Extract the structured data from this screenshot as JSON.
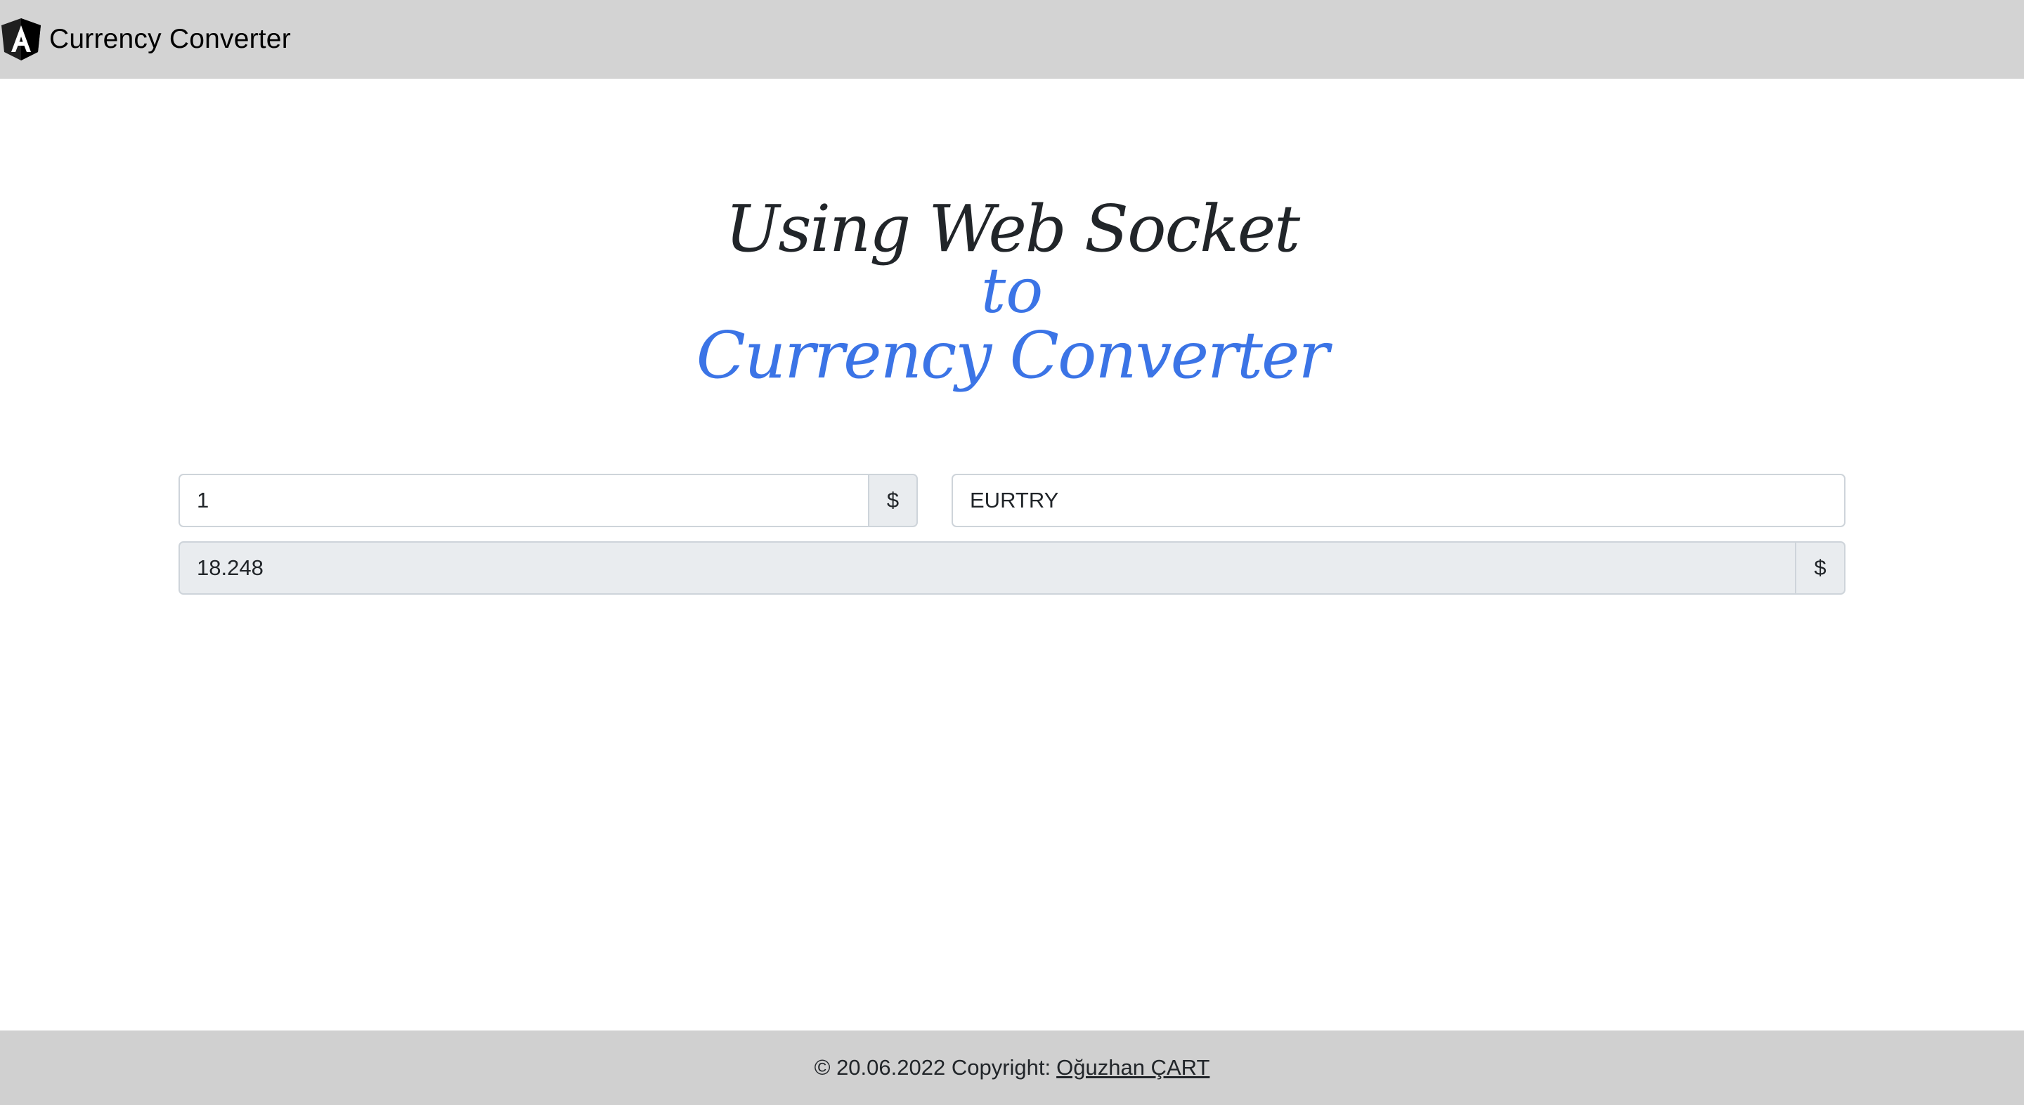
{
  "navbar": {
    "brand_title": "Currency Converter",
    "logo_icon": "angular-logo-icon",
    "background": "#d3d3d3"
  },
  "hero": {
    "line1": "Using Web Socket",
    "line2": "to",
    "line3": "Currency Converter",
    "accent_color": "#3b74e6"
  },
  "converter": {
    "amount_value": "1",
    "amount_addon": "$",
    "pair_value": "EURTRY",
    "result_value": "18.248",
    "result_addon": "$"
  },
  "footer": {
    "copyright_text": "© 20.06.2022 Copyright:",
    "author_link": "Oğuzhan ÇART",
    "background": "#d0d0d0"
  }
}
